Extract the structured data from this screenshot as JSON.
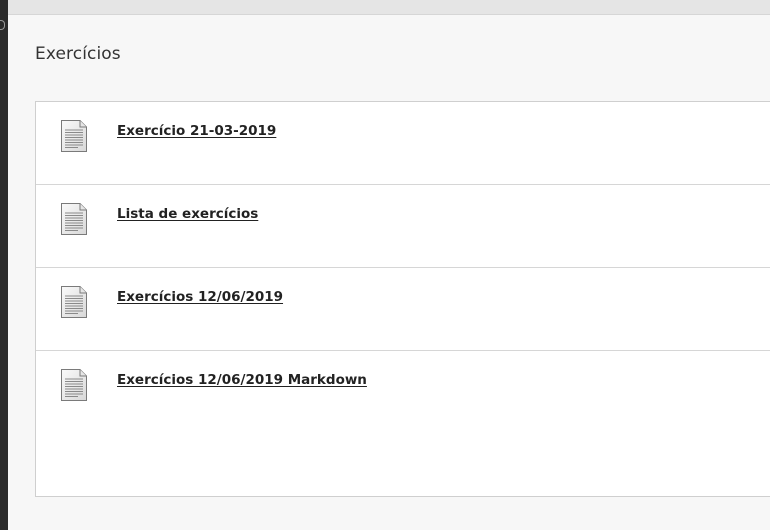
{
  "page": {
    "title": "Exercícios"
  },
  "items": [
    {
      "title": "Exercício 21-03-2019",
      "icon": "document-icon"
    },
    {
      "title": "Lista de exercícios",
      "icon": "document-icon"
    },
    {
      "title": "Exercícios 12/06/2019",
      "icon": "document-icon"
    },
    {
      "title": "Exercícios 12/06/2019 Markdown",
      "icon": "document-icon"
    }
  ],
  "colors": {
    "panel": "#ffffff",
    "background": "#f7f7f7",
    "rail": "#2b2b2b",
    "link": "#222222"
  }
}
